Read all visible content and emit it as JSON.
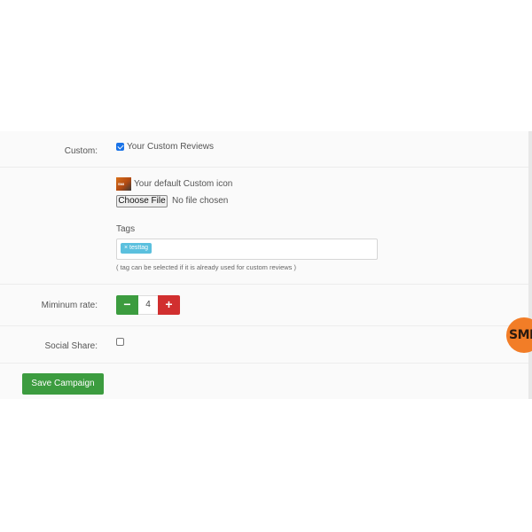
{
  "form": {
    "custom": {
      "label": "Custom:",
      "checkbox_label": "Your Custom Reviews",
      "checked": true
    },
    "icon": {
      "label": "Your default Custom icon",
      "file_button": "Choose File",
      "file_status": "No file chosen"
    },
    "tags": {
      "label": "Tags",
      "chips": [
        {
          "remove": "×",
          "text": "testtag"
        }
      ],
      "hint": "( tag can be selected if it is already used for custom reviews )"
    },
    "minimum_rate": {
      "label": "Miminum rate:",
      "minus": "−",
      "value": "4",
      "plus": "+"
    },
    "social_share": {
      "label": "Social Share:",
      "checked": false
    },
    "save_button": "Save Campaign"
  },
  "floating_badge": {
    "text": "SMI",
    "color": "#f27d27"
  },
  "colors": {
    "green": "#3c9c3f",
    "red": "#d12f2f",
    "tag": "#5bc0de",
    "checkbox": "#1a73e8"
  }
}
